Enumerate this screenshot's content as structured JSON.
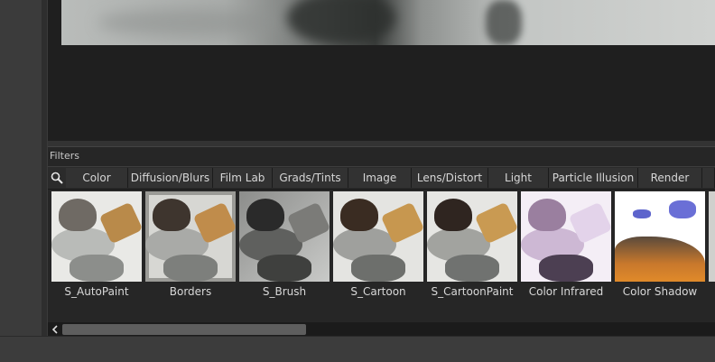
{
  "panel": {
    "title": "Filters"
  },
  "tabs": [
    {
      "label": "Color"
    },
    {
      "label": "Diffusion/Blurs"
    },
    {
      "label": "Film Lab"
    },
    {
      "label": "Grads/Tints"
    },
    {
      "label": "Image"
    },
    {
      "label": "Lens/Distort"
    },
    {
      "label": "Light"
    },
    {
      "label": "Particle Illusion"
    },
    {
      "label": "Render"
    }
  ],
  "thumbnails": [
    {
      "label": "S_AutoPaint"
    },
    {
      "label": "Borders"
    },
    {
      "label": "S_Brush"
    },
    {
      "label": "S_Cartoon"
    },
    {
      "label": "S_CartoonPaint"
    },
    {
      "label": "Color Infrared"
    },
    {
      "label": "Color Shadow"
    }
  ],
  "icons": {
    "search": "search-icon",
    "scroll_left": "chevron-left-icon"
  },
  "colors": {
    "panel_bg": "#262626",
    "tab_bg": "#323232",
    "text": "#d6d6d6"
  }
}
